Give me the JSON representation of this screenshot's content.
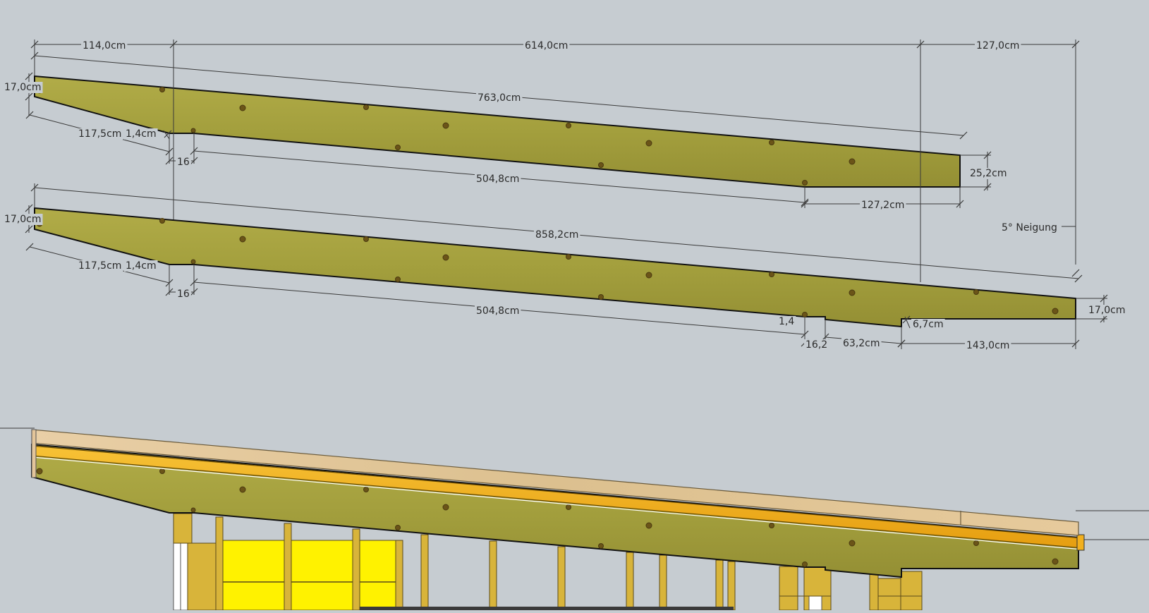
{
  "colors": {
    "background": "#c6ccd1",
    "wood": "#a5a13f",
    "wood_dark": "#8c8a30",
    "plank": "#e3c59a",
    "yellow_beam": "#f2b01e",
    "panel_yellow": "#fff200",
    "stud": "#d8b43a"
  },
  "dimensions": {
    "top_beam": {
      "d_114": "114,0cm",
      "d_614": "614,0cm",
      "d_127": "127,0cm",
      "d_17": "17,0cm",
      "d_763": "763,0cm",
      "d_117_5": "117,5cm",
      "d_1_4": "1,4cm",
      "d_16": "16",
      "d_504_8": "504,8cm",
      "d_25_2": "25,2cm",
      "d_127_2": "127,2cm"
    },
    "slope_label": "5° Neigung",
    "bottom_beam": {
      "d_17_left": "17,0cm",
      "d_858_2": "858,2cm",
      "d_117_5": "117,5cm",
      "d_1_4": "1,4cm",
      "d_16": "16",
      "d_504_8": "504,8cm",
      "d_1_4_right": "1,4",
      "d_16_right": "16,2",
      "d_63_2": "63,2cm",
      "d_6_7": "6,7cm",
      "d_143": "143,0cm",
      "d_17_right": "17,0cm"
    }
  }
}
